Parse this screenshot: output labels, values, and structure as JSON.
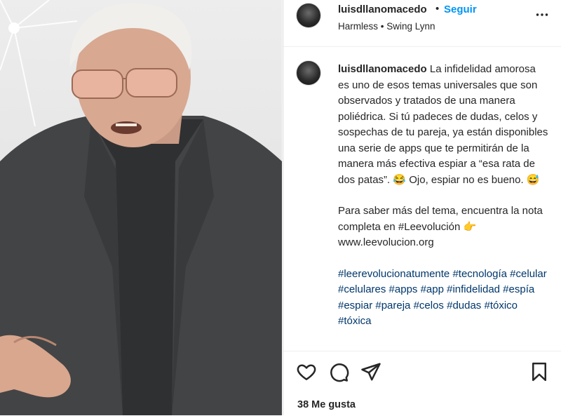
{
  "post": {
    "username": "luisdllanomacedo",
    "separator_dot": "•",
    "follow_label": "Seguir",
    "audio": "Harmless • Swing Lynn"
  },
  "caption": {
    "username": "luisdllanomacedo",
    "paragraph1": " La infidelidad amorosa es uno de esos temas universales que son observados y tratados de una manera poliédrica. Si tú padeces de dudas, celos y sospechas de tu pareja, ya están disponibles una serie de apps que te permitirán de la manera más efectiva espiar a “esa rata de dos patas”. 😂 Ojo, espiar no es bueno. 😅",
    "paragraph2": "Para saber más del tema, encuentra la nota completa en #Leevolución 👉 www.leevolucion.org",
    "hashtags": "#leerevolucionatumente #tecnología #celular #celulares #apps #app #infidelidad #espía #espiar #pareja #celos #dudas #tóxico #tóxica"
  },
  "actions": {
    "likes": "38 Me gusta",
    "icons": [
      "heart-icon",
      "comment-icon",
      "share-icon",
      "bookmark-icon"
    ]
  },
  "colors": {
    "follow": "#0095f6",
    "hashtag": "#00376b",
    "text": "#262626"
  }
}
